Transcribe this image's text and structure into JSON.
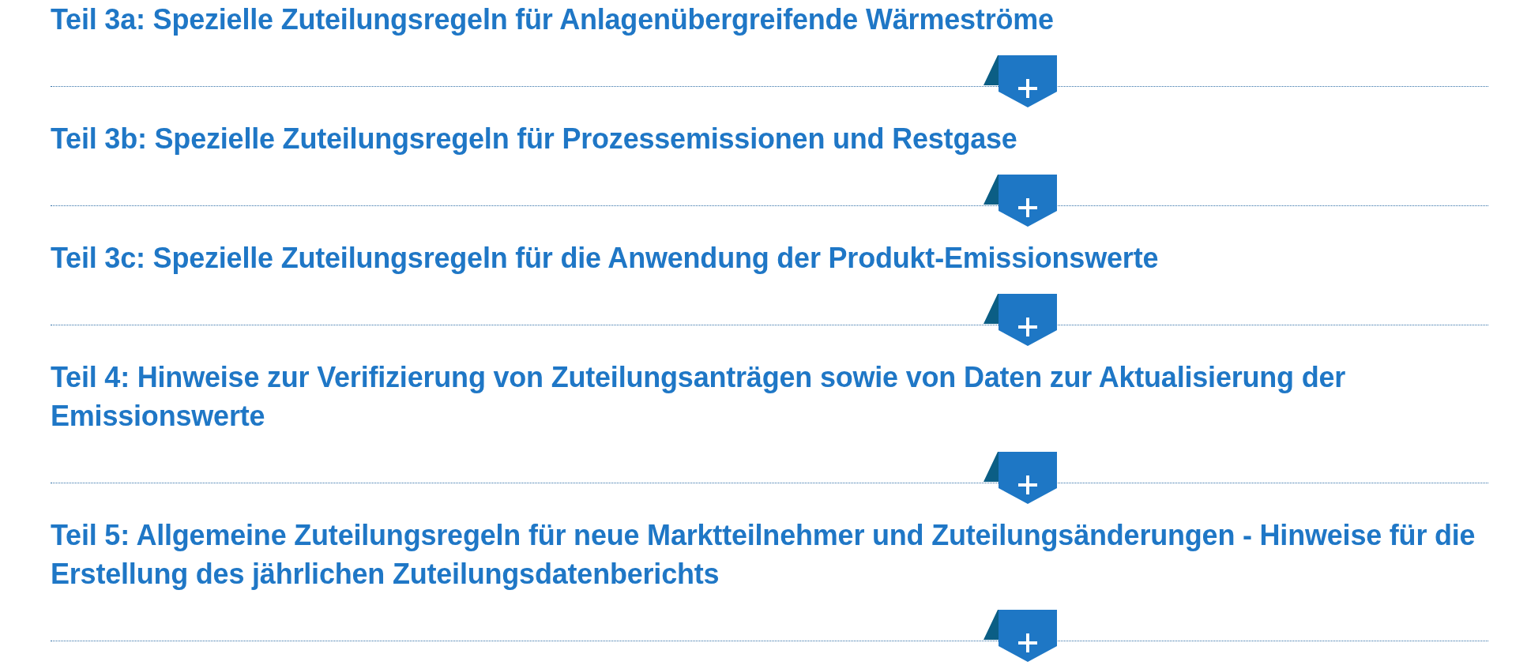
{
  "sections": [
    {
      "title": "Teil 3a: Spezielle Zuteilungsregeln für Anlagenübergreifende Wärmeströme",
      "expanded": false
    },
    {
      "title": "Teil 3b: Spezielle Zuteilungsregeln für Prozessemissionen und Restgase",
      "expanded": false
    },
    {
      "title": "Teil 3c: Spezielle Zuteilungsregeln für die Anwendung der Produkt-Emissionswerte",
      "expanded": false
    },
    {
      "title": "Teil 4: Hinweise zur Verifizierung von Zuteilungsanträgen sowie von Daten zur Aktualisierung der Emissionswerte",
      "expanded": false
    },
    {
      "title": "Teil 5: Allgemeine Zuteilungsregeln für neue Marktteilnehmer und Zuteilungsänderungen - Hinweise für die Erstellung des jährlichen Zuteilungsdatenberichts",
      "expanded": false
    }
  ]
}
